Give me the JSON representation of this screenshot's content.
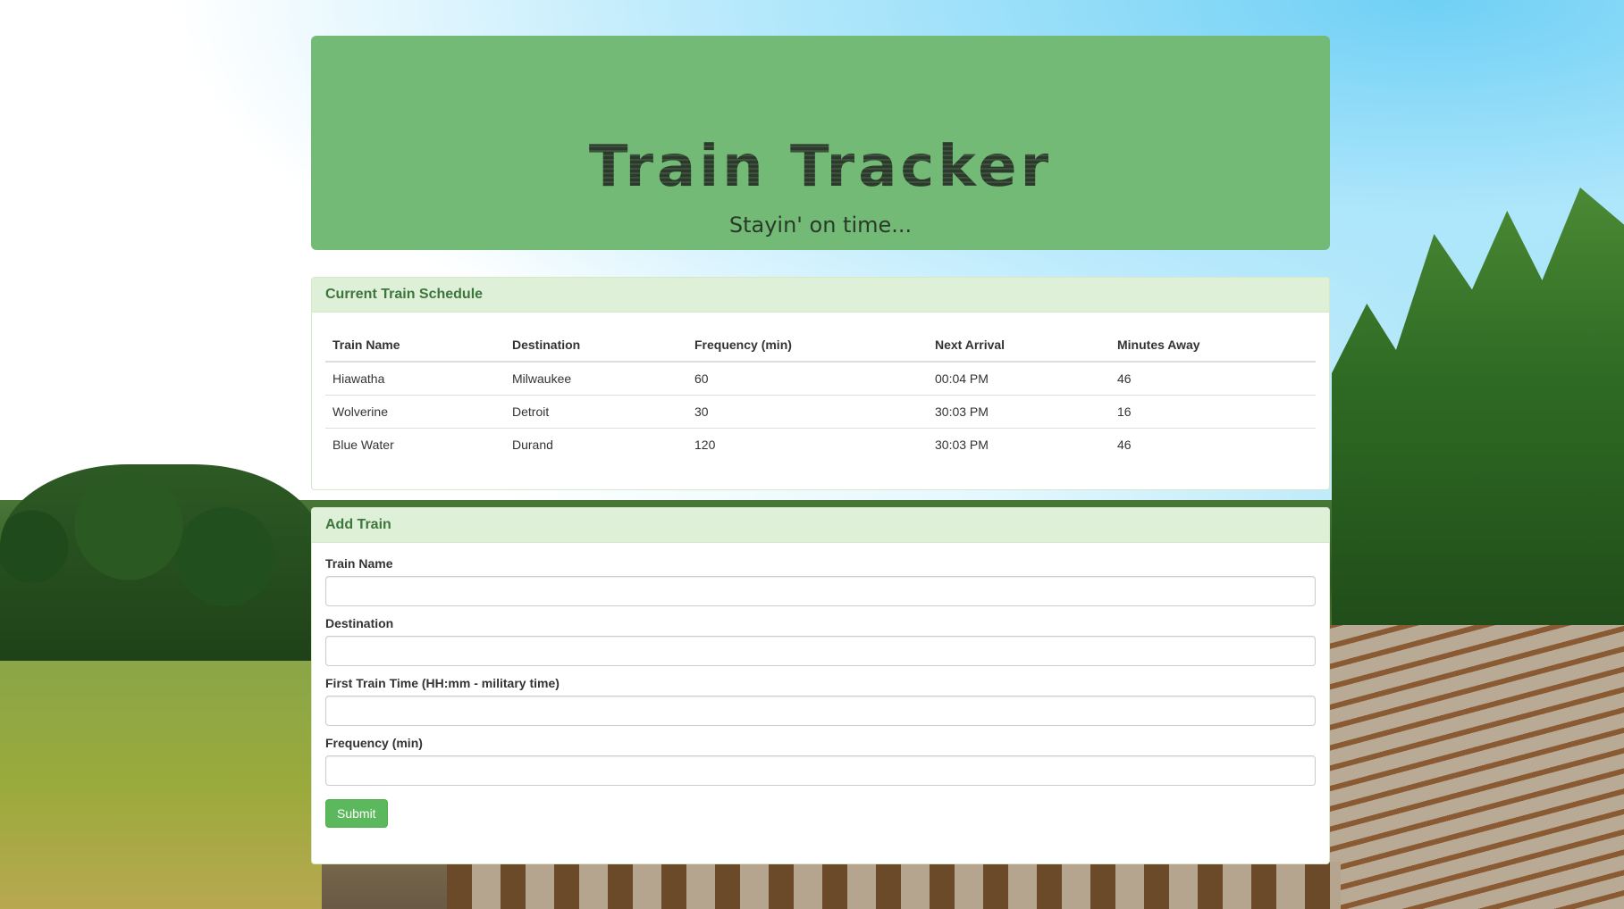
{
  "header": {
    "title": "Train Tracker",
    "subtitle": "Stayin' on time..."
  },
  "schedule": {
    "heading": "Current Train Schedule",
    "columns": [
      "Train Name",
      "Destination",
      "Frequency (min)",
      "Next Arrival",
      "Minutes Away"
    ],
    "rows": [
      [
        "Hiawatha",
        "Milwaukee",
        "60",
        "00:04 PM",
        "46"
      ],
      [
        "Wolverine",
        "Detroit",
        "30",
        "30:03 PM",
        "16"
      ],
      [
        "Blue Water",
        "Durand",
        "120",
        "30:03 PM",
        "46"
      ]
    ]
  },
  "add_train": {
    "heading": "Add Train",
    "fields": {
      "train_name": {
        "label": "Train Name",
        "value": "",
        "placeholder": ""
      },
      "destination": {
        "label": "Destination",
        "value": "",
        "placeholder": ""
      },
      "first_time": {
        "label": "First Train Time (HH:mm - military time)",
        "value": "",
        "placeholder": ""
      },
      "frequency": {
        "label": "Frequency (min)",
        "value": "",
        "placeholder": ""
      }
    },
    "submit_label": "Submit"
  },
  "colors": {
    "jumbotron": "#74ba77",
    "panel_heading": "#dff0d8",
    "panel_heading_text": "#3c763d",
    "submit_button": "#5cb85c"
  }
}
